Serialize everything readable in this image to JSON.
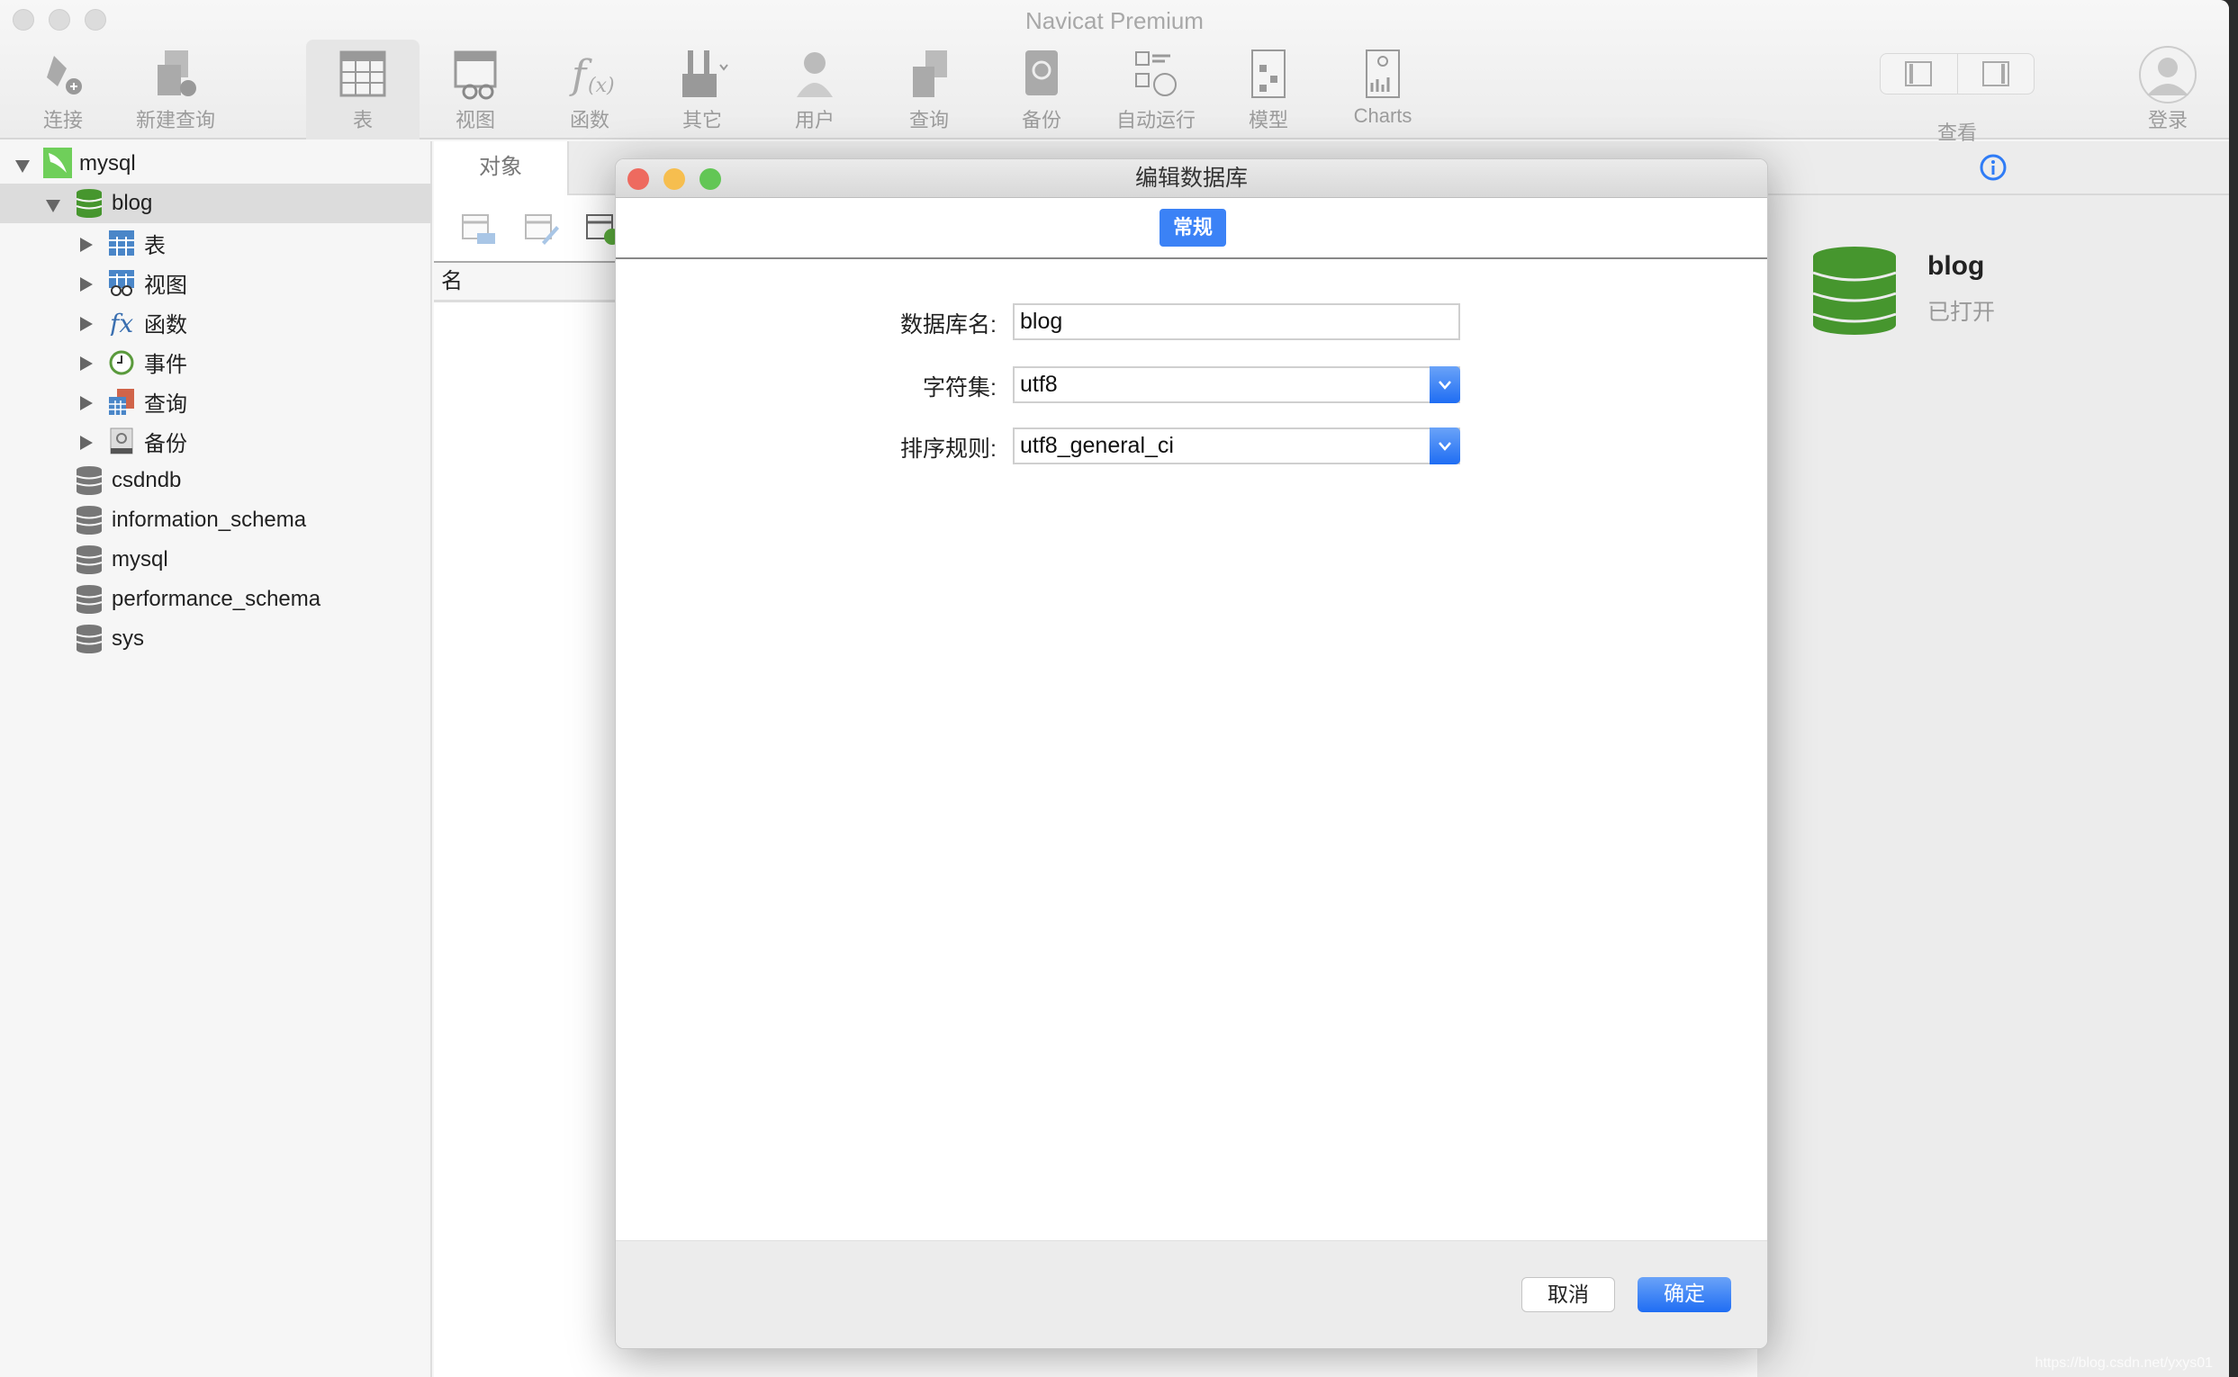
{
  "app": {
    "title": "Navicat Premium"
  },
  "toolbar": {
    "items": [
      {
        "label": "连接",
        "icon": "connect-icon"
      },
      {
        "label": "新建查询",
        "icon": "new-query-icon"
      },
      {
        "label": "表",
        "icon": "table-icon",
        "selected": true
      },
      {
        "label": "视图",
        "icon": "view-icon"
      },
      {
        "label": "函数",
        "icon": "function-icon"
      },
      {
        "label": "其它",
        "icon": "tools-icon"
      },
      {
        "label": "用户",
        "icon": "user-icon"
      },
      {
        "label": "查询",
        "icon": "query-icon"
      },
      {
        "label": "备份",
        "icon": "backup-icon"
      },
      {
        "label": "自动运行",
        "icon": "schedule-icon"
      },
      {
        "label": "模型",
        "icon": "model-icon"
      },
      {
        "label": "Charts",
        "icon": "charts-icon"
      }
    ],
    "view_label": "查看",
    "login_label": "登录"
  },
  "sidebar": {
    "connection": "mysql",
    "open_db": "blog",
    "children": [
      "表",
      "视图",
      "函数",
      "事件",
      "查询",
      "备份"
    ],
    "databases": [
      "csdndb",
      "information_schema",
      "mysql",
      "performance_schema",
      "sys"
    ]
  },
  "main": {
    "tab": "对象",
    "column_header": "名"
  },
  "info": {
    "name": "blog",
    "status": "已打开"
  },
  "dialog": {
    "title": "编辑数据库",
    "tab": "常规",
    "fields": {
      "name_label": "数据库名:",
      "name_value": "blog",
      "charset_label": "字符集:",
      "charset_value": "utf8",
      "collation_label": "排序规则:",
      "collation_value": "utf8_general_ci"
    },
    "cancel": "取消",
    "ok": "确定"
  },
  "colors": {
    "accent": "#3b82f6",
    "db_green": "#46962e"
  },
  "watermark": "https://blog.csdn.net/yxys01"
}
